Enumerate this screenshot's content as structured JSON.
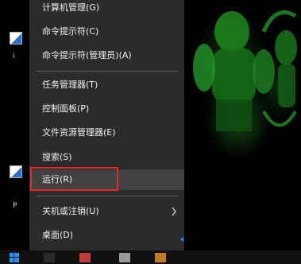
{
  "menu": {
    "items": [
      {
        "label": "计算机管理(G)"
      },
      {
        "label": "命令提示符(C)"
      },
      {
        "label": "命令提示符(管理员)(A)"
      },
      {
        "label": "任务管理器(T)"
      },
      {
        "label": "控制面板(P)"
      },
      {
        "label": "文件资源管理器(E)"
      },
      {
        "label": "搜索(S)"
      },
      {
        "label": "运行(R)"
      },
      {
        "label": "关机或注销(U)"
      },
      {
        "label": "桌面(D)"
      }
    ],
    "highlighted_item": "运行(R)",
    "highlight_color": "#e0292b",
    "background": "#2b2b2b"
  },
  "desktop": {
    "icon_labels": [
      "i",
      "P"
    ]
  },
  "colors": {
    "taskbar": "#101010",
    "accent_blue": "#2f8fe6"
  }
}
